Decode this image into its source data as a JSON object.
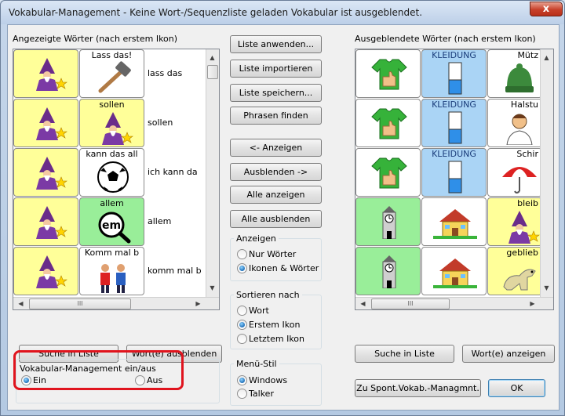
{
  "window": {
    "title": "Vokabular-Management - Keine Wort-/Sequenzliste geladen Vokabular ist ausgeblendet.",
    "close_glyph": "x"
  },
  "left_panel": {
    "label": "Angezeigte Wörter (nach erstem Ikon)",
    "rows": [
      {
        "first_icon": "wizard-icon",
        "second_caption": "Lass das!",
        "second_icon": "hammer-icon",
        "word": "lass das"
      },
      {
        "first_icon": "wizard-icon",
        "second_caption": "sollen",
        "second_icon": "wizard-icon",
        "word": "sollen"
      },
      {
        "first_icon": "wizard-icon",
        "second_caption": "kann das all",
        "second_icon": "football-icon",
        "word": "ich kann da"
      },
      {
        "first_icon": "wizard-icon",
        "second_caption": "allem",
        "second_icon": "magnifier-em-icon",
        "word": "allem"
      },
      {
        "first_icon": "wizard-icon",
        "second_caption": "Komm mal b",
        "second_icon": "people-icon",
        "word": "komm mal b"
      }
    ],
    "em_text": "em",
    "scroll_glyph": "III"
  },
  "middle_buttons": {
    "apply": "Liste anwenden...",
    "import": "Liste importieren",
    "save": "Liste speichern...",
    "find_phrases": "Phrasen finden",
    "show": "<- Anzeigen",
    "hide": "Ausblenden ->",
    "show_all": "Alle anzeigen",
    "hide_all": "Alle ausblenden"
  },
  "anzeigen": {
    "title": "Anzeigen",
    "opt1": "Nur Wörter",
    "opt2": "Ikonen & Wörter",
    "selected": "opt2"
  },
  "sortieren": {
    "title": "Sortieren nach",
    "opt1": "Wort",
    "opt2": "Erstem Ikon",
    "opt3": "Letztem Ikon",
    "selected": "opt2"
  },
  "menu_stil": {
    "title": "Menü-Stil",
    "opt1": "Windows",
    "opt2": "Talker",
    "selected": "opt1"
  },
  "right_panel": {
    "label": "Ausgeblendete Wörter (nach erstem Ikon)",
    "rows": [
      {
        "c1_icon": "shirt-thumbsup-icon",
        "c2_caption": "KLEIDUNG",
        "c2_icon": "bar-icon",
        "c3_caption": "Mütz"
      },
      {
        "c1_icon": "shirt-thumbsup-icon",
        "c2_caption": "KLEIDUNG",
        "c2_icon": "bar-icon",
        "c3_caption": "Halstu"
      },
      {
        "c1_icon": "shirt-thumbsup-icon",
        "c2_caption": "KLEIDUNG",
        "c2_icon": "bar-icon",
        "c3_caption": "Schir"
      },
      {
        "c1_icon": "clock-tower-icon",
        "c2_caption": "",
        "c2_icon": "house-icon",
        "c3_caption": "bleib"
      },
      {
        "c1_icon": "clock-tower-icon",
        "c2_caption": "",
        "c2_icon": "house-icon",
        "c3_caption": "geblieb"
      }
    ],
    "scroll_glyph": "III"
  },
  "bottom": {
    "search_left": "Suche in Liste",
    "hide_words": "Wort(e) ausblenden",
    "search_right": "Suche in Liste",
    "show_words": "Wort(e) anzeigen",
    "spont": "Zu Spont.Vokab.-Managmnt.",
    "ok": "OK"
  },
  "vm_toggle": {
    "title": "Vokabular-Management ein/aus",
    "on": "Ein",
    "off": "Aus",
    "selected": "on"
  },
  "colors": {
    "yellow_cell": "#ffff99",
    "green_cell": "#99ee99",
    "blue_cell": "#aad4f5",
    "highlight": "#e0141e"
  }
}
